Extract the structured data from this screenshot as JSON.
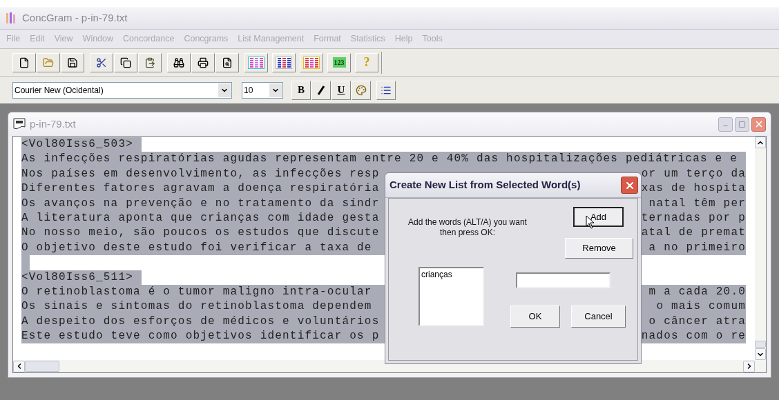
{
  "window": {
    "title": "ConcGram - p-in-79.txt"
  },
  "menu": [
    {
      "label": "File",
      "disabled": true
    },
    {
      "label": "Edit",
      "disabled": true
    },
    {
      "label": "View",
      "disabled": true
    },
    {
      "label": "Window",
      "disabled": true
    },
    {
      "label": "Concordance",
      "disabled": true
    },
    {
      "label": "Concgrams",
      "disabled": true
    },
    {
      "label": "List Management",
      "disabled": true
    },
    {
      "label": "Format",
      "disabled": true
    },
    {
      "label": "Statistics",
      "disabled": true
    },
    {
      "label": "Help",
      "disabled": true
    },
    {
      "label": "Tools",
      "disabled": true
    }
  ],
  "toolbar": {
    "number_button": "123",
    "help_button": "?"
  },
  "format_bar": {
    "font": "Courier New (Ocidental)",
    "size": "10",
    "bold": "B",
    "underline": "U"
  },
  "document": {
    "title": "p-in-79.txt",
    "lines": [
      {
        "kind": "tag",
        "left": "<Vol80Iss6_503>",
        "selected": true
      },
      {
        "kind": "text",
        "left": "As infecções respiratórias agudas representam entre 20 e 40% das hospitalizações pediátricas e e",
        "selected": true
      },
      {
        "kind": "text",
        "left": "Nos países em desenvolvimento, as infecções resp",
        "right": "or um terço da",
        "selected": true
      },
      {
        "kind": "text",
        "left": "Diferentes fatores agravam a doença respiratória",
        "right": "xas de hospita",
        "selected": true
      },
      {
        "kind": "text",
        "left": "Os avanços na prevenção e no tratamento da síndr",
        "right": "natal têm per",
        "selected": true
      },
      {
        "kind": "text",
        "left": "A literatura aponta que crianças com idade gesta",
        "right": "ternadas por p",
        "selected": true
      },
      {
        "kind": "text",
        "left": "No nosso meio, são poucos os estudos que discute",
        "right": "atal de premat",
        "selected": true
      },
      {
        "kind": "text",
        "left": "O objetivo deste estudo foi verificar a taxa de",
        "right": "a no primeiro",
        "selected": true
      },
      {
        "kind": "blank",
        "selected": true
      },
      {
        "kind": "tag",
        "left": "<Vol80Iss6_511>",
        "selected": true
      },
      {
        "kind": "text",
        "left": "O retinoblastoma é o tumor maligno intra-ocular",
        "right": "m a cada 20.0",
        "selected": true
      },
      {
        "kind": "text",
        "left": "Os sinais e sintomas do retinoblastoma dependem",
        "right": "o mais comum",
        "selected": true
      },
      {
        "kind": "text",
        "left": "A despeito dos esforços de médicos e voluntários",
        "right": "o câncer atra",
        "selected": true
      },
      {
        "kind": "text",
        "left": "Este estudo teve como objetivos identificar os p",
        "right": "nados com o re",
        "selected": true
      }
    ]
  },
  "dialog": {
    "title": "Create New List from Selected Word(s)",
    "prompt": "Add the words (ALT/A) you want then press OK:",
    "add_button": {
      "label": "Add",
      "focused": true
    },
    "remove_button": "Remove",
    "list_items": [
      "crianças"
    ],
    "ok_button": "OK",
    "cancel_button": "Cancel"
  }
}
